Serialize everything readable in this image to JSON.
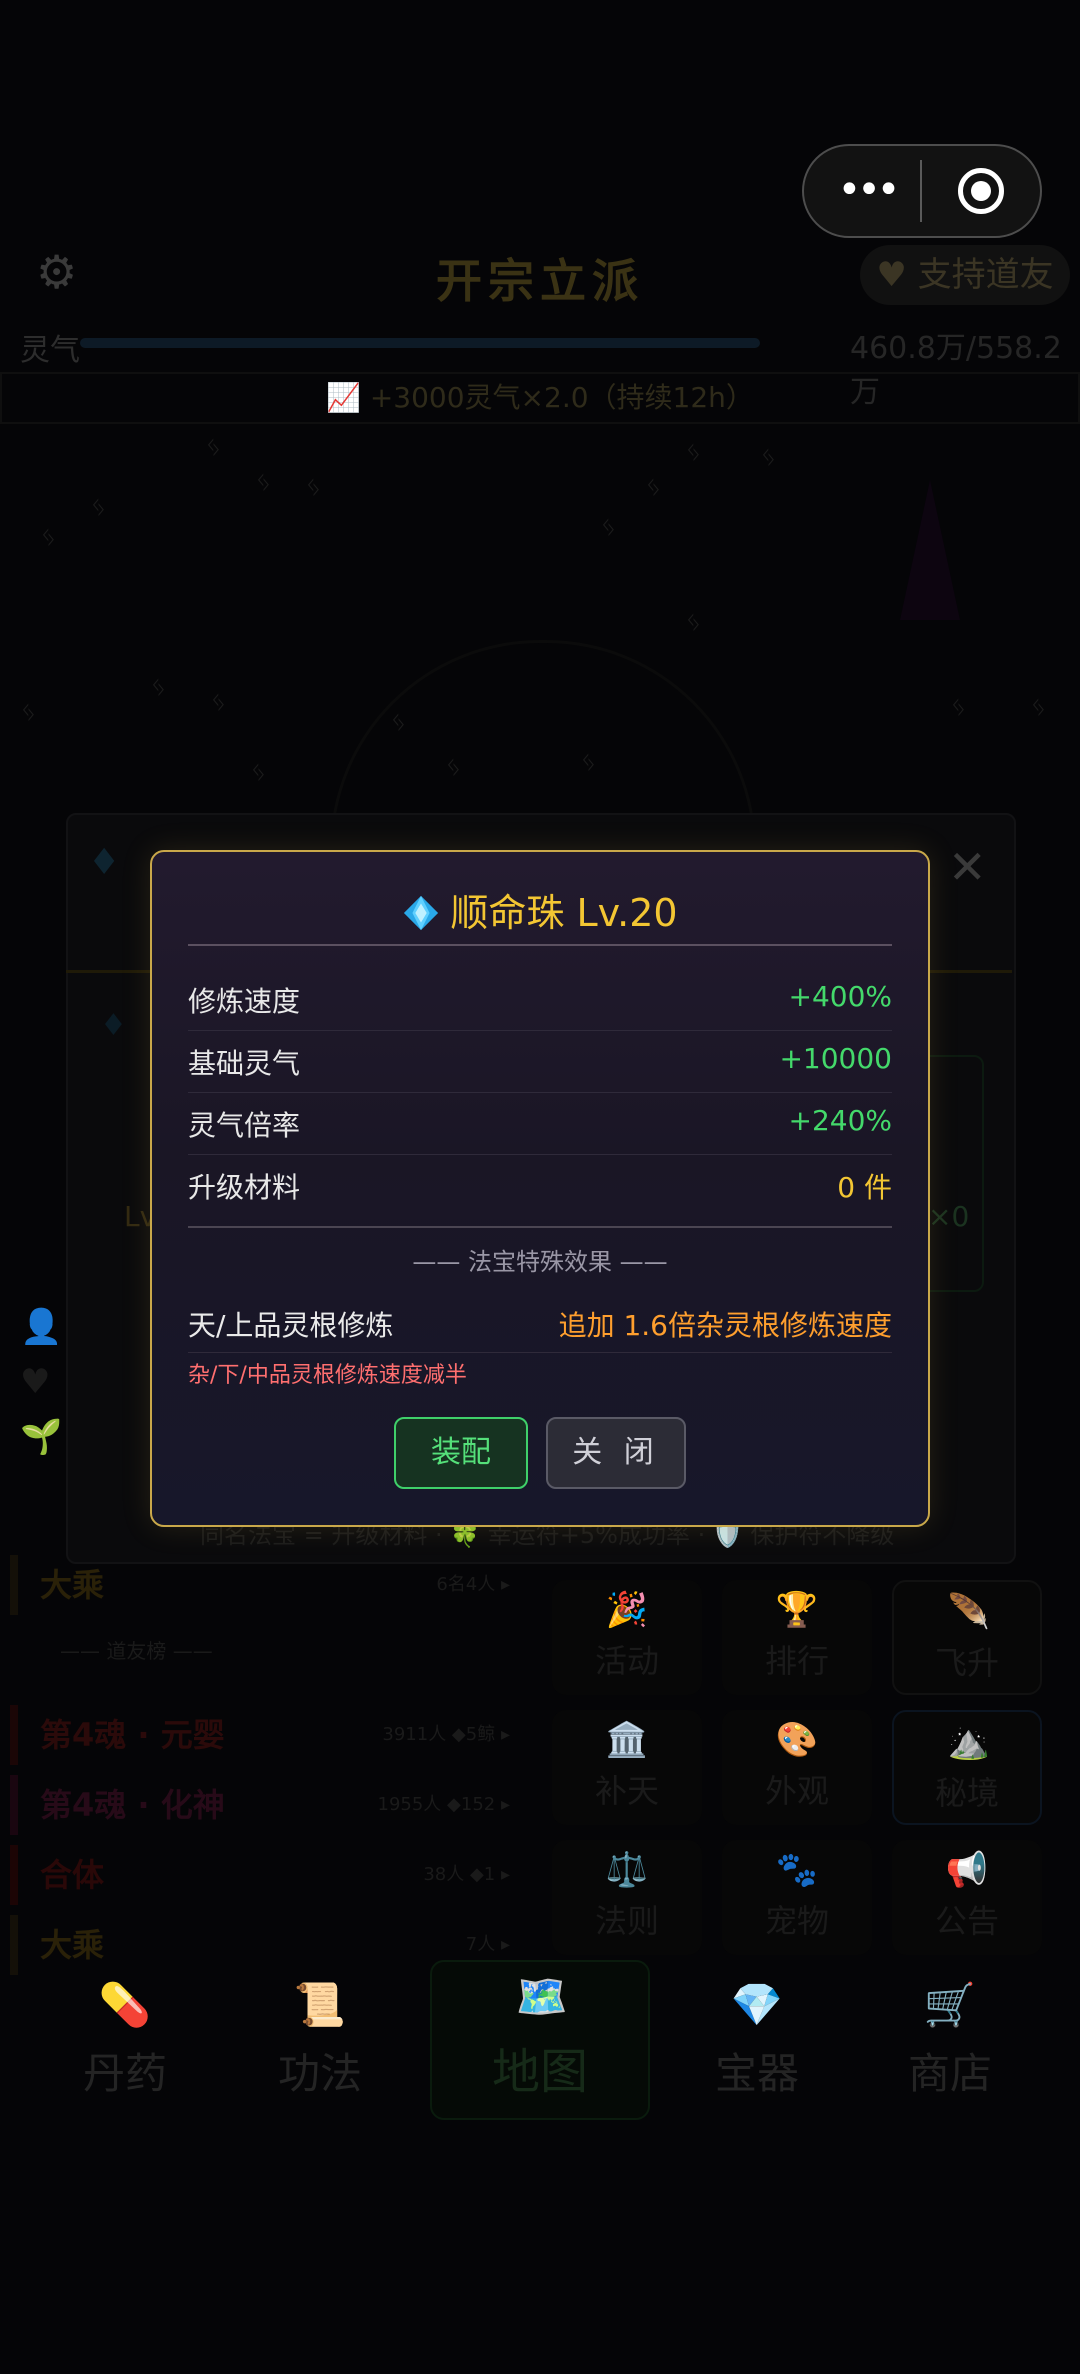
{
  "background": {
    "title": "开宗立派",
    "support_label": "支持道友",
    "qi_label": "灵气",
    "qi_value": "460.8万/558.2万",
    "boost_text": "📈 +3000灵气×2.0（持续12h）",
    "panel_left_text": "Lv",
    "panel_right_text": "×0",
    "panel_tip": "同名法宝 = 升级材料 · 🍀 幸运符+5%成功率 · 🛡️ 保护符不降级",
    "list_items": [
      {
        "label": "大乘",
        "meta": "6名4人 ▸"
      },
      {
        "label": "第4魂 · 元婴",
        "meta": "3911人 ◆5鲸 ▸"
      },
      {
        "label": "第4魂 · 化神",
        "meta": "1955人 ◆152 ▸"
      },
      {
        "label": "合体",
        "meta": "38人 ◆1 ▸"
      },
      {
        "label": "大乘",
        "meta": "7人 ▸"
      }
    ],
    "list_subheader": "—— 道友榜 ——",
    "grid_buttons": [
      {
        "label": "活动",
        "icon": "🎉"
      },
      {
        "label": "排行",
        "icon": "🏆"
      },
      {
        "label": "飞升",
        "icon": "🪶"
      },
      {
        "label": "补天",
        "icon": "🏛️"
      },
      {
        "label": "外观",
        "icon": "🎨"
      },
      {
        "label": "秘境",
        "icon": "⛰️"
      },
      {
        "label": "法则",
        "icon": "⚖️"
      },
      {
        "label": "宠物",
        "icon": "🐾"
      },
      {
        "label": "公告",
        "icon": "📢"
      }
    ],
    "nav": [
      {
        "label": "丹药",
        "icon": "💊"
      },
      {
        "label": "功法",
        "icon": "📜"
      },
      {
        "label": "地图",
        "icon": "🗺️"
      },
      {
        "label": "宝器",
        "icon": "💎"
      },
      {
        "label": "商店",
        "icon": "🛒"
      }
    ]
  },
  "modal": {
    "title": "顺命珠 Lv.20",
    "stats": [
      {
        "label": "修炼速度",
        "value": "+400%"
      },
      {
        "label": "基础灵气",
        "value": "+10000"
      },
      {
        "label": "灵气倍率",
        "value": "+240%"
      },
      {
        "label": "升级材料",
        "value": "0 件"
      }
    ],
    "section_title": "—— 法宝特殊效果 ——",
    "effect_label": "天/上品灵根修炼",
    "effect_value": "追加 1.6倍杂灵根修炼速度",
    "effect_note": "杂/下/中品灵根修炼速度减半",
    "equip_label": "装配",
    "close_label": "关 闭"
  },
  "capsule": {
    "more_label": "•••"
  },
  "colors": {
    "gold": "#f3c633",
    "green": "#44d96b",
    "orange": "#ff9f2e",
    "red": "#ff6f6f"
  }
}
